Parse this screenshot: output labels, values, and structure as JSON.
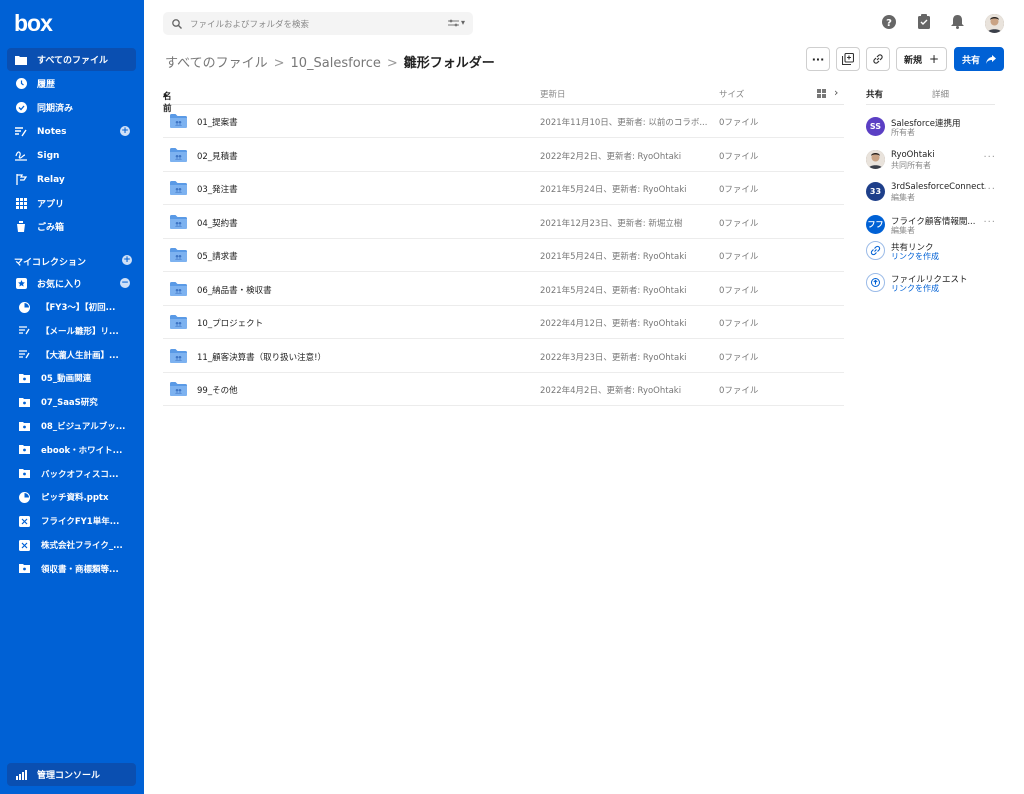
{
  "brand": {
    "logo": "box",
    "color": "#0061d5"
  },
  "sidebar": {
    "nav": [
      {
        "label": "すべてのファイル",
        "icon": "folder-icon"
      },
      {
        "label": "履歴",
        "icon": "clock-icon"
      },
      {
        "label": "同期済み",
        "icon": "check-circle-icon"
      },
      {
        "label": "Notes",
        "icon": "notes-icon"
      },
      {
        "label": "Sign",
        "icon": "sign-icon"
      },
      {
        "label": "Relay",
        "icon": "relay-icon"
      },
      {
        "label": "アプリ",
        "icon": "apps-grid-icon"
      },
      {
        "label": "ごみ箱",
        "icon": "trash-icon"
      }
    ],
    "my_collection": "マイコレクション",
    "favorites": "お気に入り",
    "favorite_items": [
      {
        "label": "【FY3〜】【初回...",
        "icon": "powerpoint-icon"
      },
      {
        "label": "【メール雛形】リ...",
        "icon": "note-icon"
      },
      {
        "label": "【大瀧人生計画】...",
        "icon": "note-icon"
      },
      {
        "label": "05_動画関連",
        "icon": "folder-icon"
      },
      {
        "label": "07_SaaS研究",
        "icon": "folder-icon"
      },
      {
        "label": "08_ビジュアルブッ...",
        "icon": "folder-icon"
      },
      {
        "label": "ebook・ホワイト...",
        "icon": "folder-icon"
      },
      {
        "label": "バックオフィスコ...",
        "icon": "folder-icon"
      },
      {
        "label": "ピッチ資料.pptx",
        "icon": "powerpoint-icon"
      },
      {
        "label": "フライクFY1単年...",
        "icon": "excel-icon"
      },
      {
        "label": "株式会社フライク_...",
        "icon": "excel-icon"
      },
      {
        "label": "領収書・商標類等...",
        "icon": "folder-icon"
      }
    ],
    "admin": "管理コンソール"
  },
  "search": {
    "placeholder": "ファイルおよびフォルダを検索"
  },
  "breadcrumb": {
    "root": "すべてのファイル",
    "parent": "10_Salesforce",
    "current": "雛形フォルダー"
  },
  "actions": {
    "more": "···",
    "new": "新規",
    "share": "共有"
  },
  "table": {
    "headers": {
      "name": "名前",
      "updated": "更新日",
      "size": "サイズ"
    },
    "rows": [
      {
        "name": "01_提案書",
        "updated": "2021年11月10日、更新者: 以前のコラボ...",
        "size": "0ファイル"
      },
      {
        "name": "02_見積書",
        "updated": "2022年2月2日、更新者: RyoOhtaki",
        "size": "0ファイル"
      },
      {
        "name": "03_発注書",
        "updated": "2021年5月24日、更新者: RyoOhtaki",
        "size": "0ファイル"
      },
      {
        "name": "04_契約書",
        "updated": "2021年12月23日、更新者: 新堀立樹",
        "size": "0ファイル"
      },
      {
        "name": "05_請求書",
        "updated": "2021年5月24日、更新者: RyoOhtaki",
        "size": "0ファイル"
      },
      {
        "name": "06_納品書・検収書",
        "updated": "2021年5月24日、更新者: RyoOhtaki",
        "size": "0ファイル"
      },
      {
        "name": "10_プロジェクト",
        "updated": "2022年4月12日、更新者: RyoOhtaki",
        "size": "0ファイル"
      },
      {
        "name": "11_顧客決算書（取り扱い注意!）",
        "updated": "2022年3月23日、更新者: RyoOhtaki",
        "size": "0ファイル"
      },
      {
        "name": "99_その他",
        "updated": "2022年4月2日、更新者: RyoOhtaki",
        "size": "0ファイル"
      }
    ]
  },
  "panel": {
    "tabs": {
      "share": "共有",
      "details": "詳細"
    },
    "collaborators": [
      {
        "initials": "SS",
        "name": "Salesforce連携用",
        "role": "所有者",
        "color": "#5b3fc4"
      },
      {
        "initials": "",
        "name": "RyoOhtaki",
        "role": "共同所有者",
        "color": "#8a7a6a"
      },
      {
        "initials": "33",
        "name": "3rdSalesforceConnect",
        "role": "編集者",
        "color": "#1e3f8a"
      },
      {
        "initials": "フフ",
        "name": "フライク顧客情報閲...",
        "role": "編集者",
        "color": "#0061d5"
      }
    ],
    "shared_link": {
      "title": "共有リンク",
      "action": "リンクを作成"
    },
    "file_request": {
      "title": "ファイルリクエスト",
      "action": "リンクを作成"
    }
  }
}
